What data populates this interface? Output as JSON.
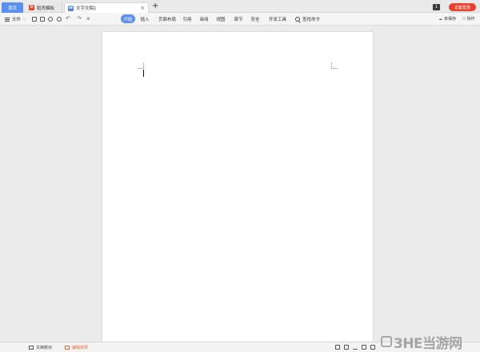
{
  "tabs": {
    "home": "首页",
    "store": "稻壳模板",
    "doc": "文字文稿1",
    "doc_icon": "W",
    "store_icon": "D",
    "close": "×",
    "new_tab": "+"
  },
  "titlebar": {
    "badge": "1",
    "login": "访客登录"
  },
  "toolbar": {
    "file_label": "文件",
    "file_chevron": "⌵",
    "undo": "↶",
    "redo": "↷",
    "more": "⊕",
    "ribbon": [
      "开始",
      "插入",
      "页面布局",
      "引用",
      "审阅",
      "视图",
      "章节",
      "安全",
      "开发工具"
    ],
    "active_index": 0,
    "search": "查找命令",
    "cloud_save": "未保存",
    "collab": "协作"
  },
  "statusbar": {
    "proofread": "文档校对",
    "notice": "编辑受限"
  },
  "watermark": {
    "text": "3HE当游网"
  }
}
